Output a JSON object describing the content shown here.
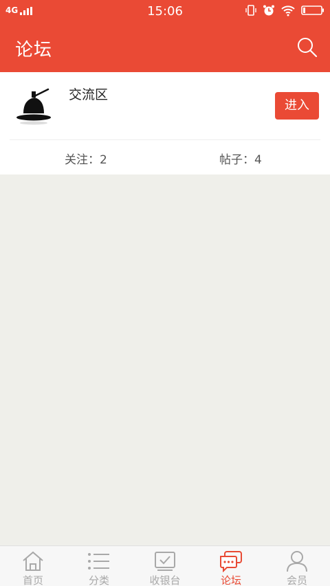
{
  "status_bar": {
    "network": "4G",
    "time": "15:06"
  },
  "header": {
    "title": "论坛",
    "search_icon": "search-icon",
    "background_color": "#ea4a35"
  },
  "forum": {
    "name": "交流区",
    "enter_label": "进入",
    "follow_text": "关注：2",
    "posts_text": "帖子：4"
  },
  "tabbar": {
    "active_color": "#e84a34",
    "inactive_color": "#a8a8a8",
    "tabs": [
      {
        "label": "首页",
        "icon": "home-icon",
        "active": false
      },
      {
        "label": "分类",
        "icon": "list-icon",
        "active": false
      },
      {
        "label": "收银台",
        "icon": "checkout-icon",
        "active": false
      },
      {
        "label": "论坛",
        "icon": "chat-icon",
        "active": true
      },
      {
        "label": "会员",
        "icon": "user-icon",
        "active": false
      }
    ]
  }
}
